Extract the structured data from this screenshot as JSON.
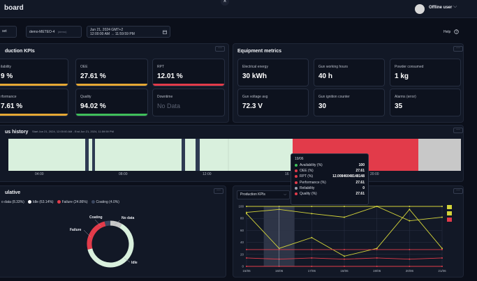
{
  "header": {
    "title": "board",
    "close_icon": "×",
    "user_name": "Offline user",
    "chevron": "⌵"
  },
  "controls": {
    "reset_label": "set",
    "site_label": "demo-METEO-4",
    "site_tag": "(demo)",
    "date_line1": "Jun 21, 2024 GMT+2",
    "date_line2": "12:00:00 AM → 11:59:59 PM",
    "help_label": "Help"
  },
  "production_kpis": {
    "title": "duction KPIs",
    "cards": [
      {
        "label": "ilability",
        "value": "9 %",
        "bar_color": "#e6a833",
        "bar_fill": 0.99
      },
      {
        "label": "OEE",
        "value": "27.61 %",
        "bar_color": "#e6a833",
        "bar_fill": 0.2761
      },
      {
        "label": "RPT",
        "value": "12.01 %",
        "bar_color": "#e23b4a",
        "bar_fill": 0.1201
      },
      {
        "label": "rformance",
        "value": "7.61 %",
        "bar_color": "#e6a833",
        "bar_fill": 0.2761
      },
      {
        "label": "Quality",
        "value": "94.02 %",
        "bar_color": "#3fbf5a",
        "bar_fill": 0.9402
      },
      {
        "label": "Downtime",
        "value": "No Data",
        "bar_color": "",
        "bar_fill": 0
      }
    ]
  },
  "equipment_metrics": {
    "title": "Equipment metrics",
    "cards": [
      {
        "label": "Electrical energy",
        "value": "30 kWh"
      },
      {
        "label": "Gun working hours",
        "value": "40 h"
      },
      {
        "label": "Powder consumed",
        "value": "1 kg"
      },
      {
        "label": "Gun voltage avg",
        "value": "72.3 V"
      },
      {
        "label": "Gun ignition counter",
        "value": "30"
      },
      {
        "label": "Alarms (error)",
        "value": "35"
      }
    ]
  },
  "status_history": {
    "title": "us history",
    "subtitle": "Start Jun 21, 2024, 12:00:00 AM - End Jun 21, 2024, 11:59:59 PM",
    "time_labels": [
      "04:00",
      "08:00",
      "12:00",
      "16",
      "20:00"
    ],
    "colors": {
      "idle": "#d9f0dd",
      "coating": "#2e3a52",
      "failure": "#e23b4a",
      "no_data": "#c8c8c8"
    }
  },
  "tooltip": {
    "date": "19/06",
    "rows": [
      {
        "name": "Availability (%)",
        "value": "100",
        "color": "#3fbf5a"
      },
      {
        "name": "OEE (%)",
        "value": "27.61",
        "color": "#e23b4a"
      },
      {
        "name": "RPT (%)",
        "value": "12.00846048148148",
        "color": "#e23b4a"
      },
      {
        "name": "Performance (%)",
        "value": "27.61",
        "color": "#e23b4a"
      },
      {
        "name": "Reliability",
        "value": "0",
        "color": "#9aa1b0"
      },
      {
        "name": "Quality (%)",
        "value": "27.61",
        "color": "#e23b4a"
      }
    ]
  },
  "cumulative": {
    "title": "ulative",
    "legend": [
      {
        "label": "o data (8.33%)",
        "color": ""
      },
      {
        "label": "Idle (63.14%)",
        "color": "#ffffff"
      },
      {
        "label": "Failure (24.86%)",
        "color": "#e23b4a"
      },
      {
        "label": "Coating (4.0%)",
        "color": "#3b4760"
      }
    ],
    "donut_labels": {
      "coating": "Coating",
      "no_data": "No data",
      "failure": "Failure",
      "idle": "Idle"
    }
  },
  "kpi_chart": {
    "select_label": "Production KPIs"
  },
  "chart_data": [
    {
      "type": "pie",
      "categories": [
        "No data",
        "Idle",
        "Failure",
        "Coating"
      ],
      "values": [
        8.33,
        63.14,
        24.86,
        4.0
      ],
      "colors": [
        "#c8c8c8",
        "#d9f0dd",
        "#e23b4a",
        "#3b4760"
      ]
    },
    {
      "type": "line",
      "categories": [
        "15/06",
        "16/06",
        "17/06",
        "18/06",
        "19/06",
        "20/06",
        "21/06"
      ],
      "ylim": [
        0,
        100
      ],
      "yticks": [
        0,
        20,
        40,
        60,
        80,
        100
      ],
      "series": [
        {
          "values": [
            100,
            100,
            100,
            100,
            100,
            100,
            100
          ],
          "color": "#d4d43a"
        },
        {
          "values": [
            88,
            30,
            48,
            17,
            30,
            95,
            30
          ],
          "color": "#d4d43a"
        },
        {
          "values": [
            90,
            95,
            88,
            82,
            100,
            76,
            82
          ],
          "color": "#d4d43a"
        },
        {
          "values": [
            28,
            28,
            28,
            28,
            28,
            28,
            28
          ],
          "color": "#e23b4a"
        },
        {
          "values": [
            14,
            12,
            14,
            12,
            14,
            12,
            14
          ],
          "color": "#e23b4a"
        },
        {
          "values": [
            0,
            0,
            0,
            0,
            0,
            0,
            0
          ],
          "color": "#e23b4a"
        }
      ]
    }
  ]
}
